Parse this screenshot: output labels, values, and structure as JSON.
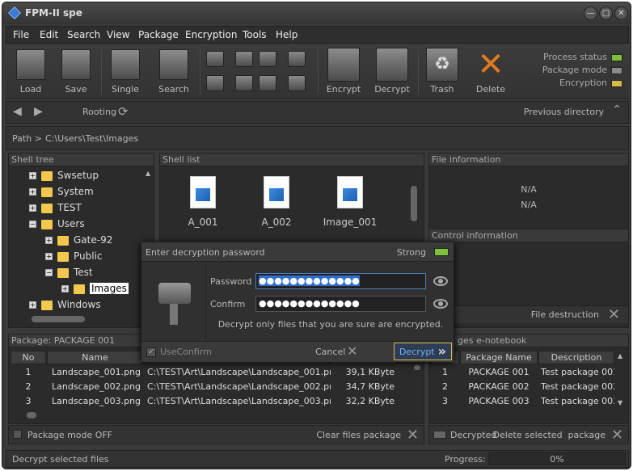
{
  "window": {
    "title": "FPM-II spe",
    "min": "—",
    "max": "□",
    "close": "✕"
  },
  "menu": [
    "File",
    "Edit",
    "Search",
    "View",
    "Package",
    "Encryption",
    "Tools",
    "Help"
  ],
  "toolbar": {
    "load": "Load",
    "save": "Save",
    "single": "Single",
    "search": "Search",
    "encrypt": "Encrypt",
    "decrypt": "Decrypt",
    "trash": "Trash",
    "delete": "Delete"
  },
  "status": {
    "process": "Process status",
    "package": "Package mode",
    "encryption": "Encryption",
    "colors": {
      "process": "#7dc23b",
      "package": "#8a8a8a",
      "encryption": "#d9b84a"
    }
  },
  "nav": {
    "rooting": "Rooting",
    "previous": "Previous directory"
  },
  "path": {
    "label": "Path >",
    "value": "C:\\Users\\Test\\Images"
  },
  "shell_tree": {
    "title": "Shell tree",
    "items": [
      "Swsetup",
      "System",
      "TEST",
      "Users",
      "Gate-92",
      "Public",
      "Test",
      "Images",
      "Windows"
    ]
  },
  "shell_list": {
    "title": "Shell list",
    "files": [
      "A_001",
      "A_002",
      "Image_001"
    ]
  },
  "file_info": {
    "title": "File information",
    "line1": "N/A",
    "line2": "N/A"
  },
  "control_info": {
    "title": "Control information",
    "file_destruction": "File destruction"
  },
  "package": {
    "title": "Package: PACKAGE 001",
    "columns": [
      "No",
      "Name"
    ],
    "rows": [
      {
        "no": "1",
        "name": "Landscape_001.png",
        "path": "C:\\TEST\\Art\\Landscape\\Landscape_001.png",
        "size": "39,1 KByte"
      },
      {
        "no": "2",
        "name": "Landscape_002.png",
        "path": "C:\\TEST\\Art\\Landscape\\Landscape_002.png",
        "size": "34,7 KByte"
      },
      {
        "no": "3",
        "name": "Landscape_003.png",
        "path": "C:\\TEST\\Art\\Landscape\\Landscape_003.png",
        "size": "32,2 KByte"
      }
    ],
    "mode_off": "Package mode OFF",
    "clear": "Clear files package"
  },
  "notebook": {
    "title": "ges e-notebook",
    "columns": [
      "Package Name",
      "Description"
    ],
    "rows": [
      {
        "no": "1",
        "name": "PACKAGE 001",
        "desc": "Test package 001"
      },
      {
        "no": "2",
        "name": "PACKAGE 002",
        "desc": "Test package 002"
      },
      {
        "no": "3",
        "name": "PACKAGE 003",
        "desc": "Test package 003"
      }
    ],
    "decrypted": "Decrypted",
    "delete_selected": "Delete selected  package"
  },
  "dialog": {
    "title": "Enter decryption password",
    "strength": "Strong",
    "password_label": "Password",
    "password_value": "●●●●●●●●●●●●●",
    "confirm_label": "Confirm",
    "confirm_value": "●●●●●●●●●●●●●",
    "hint": "Decrypt only files that you are sure are encrypted.",
    "use_confirm": "UseConfirm",
    "cancel": "Cancel",
    "decrypt": "Decrypt"
  },
  "bottom": {
    "status": "Decrypt selected files",
    "progress_label": "Progress:",
    "progress_value": "0%",
    "progress": 0
  }
}
